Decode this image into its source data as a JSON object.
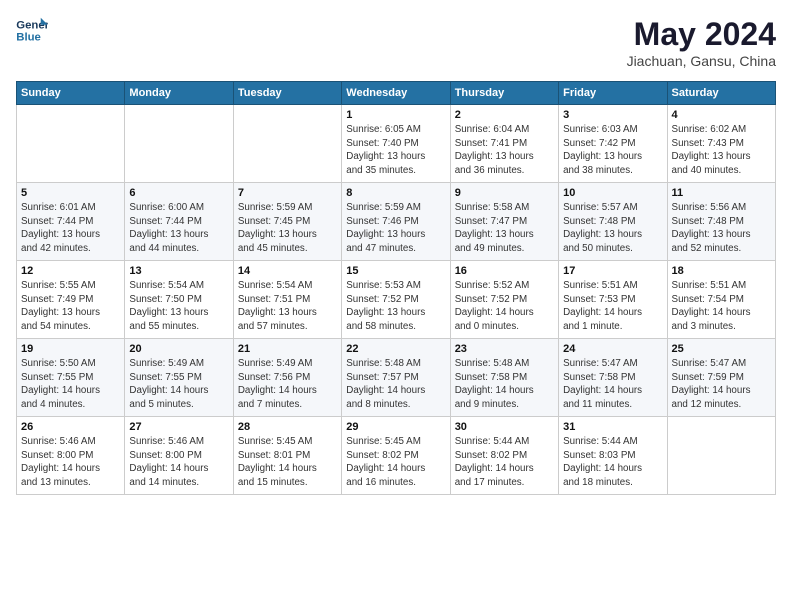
{
  "header": {
    "logo_line1": "General",
    "logo_line2": "Blue",
    "month_year": "May 2024",
    "location": "Jiachuan, Gansu, China"
  },
  "days_of_week": [
    "Sunday",
    "Monday",
    "Tuesday",
    "Wednesday",
    "Thursday",
    "Friday",
    "Saturday"
  ],
  "weeks": [
    [
      {
        "day": "",
        "info": ""
      },
      {
        "day": "",
        "info": ""
      },
      {
        "day": "",
        "info": ""
      },
      {
        "day": "1",
        "info": "Sunrise: 6:05 AM\nSunset: 7:40 PM\nDaylight: 13 hours\nand 35 minutes."
      },
      {
        "day": "2",
        "info": "Sunrise: 6:04 AM\nSunset: 7:41 PM\nDaylight: 13 hours\nand 36 minutes."
      },
      {
        "day": "3",
        "info": "Sunrise: 6:03 AM\nSunset: 7:42 PM\nDaylight: 13 hours\nand 38 minutes."
      },
      {
        "day": "4",
        "info": "Sunrise: 6:02 AM\nSunset: 7:43 PM\nDaylight: 13 hours\nand 40 minutes."
      }
    ],
    [
      {
        "day": "5",
        "info": "Sunrise: 6:01 AM\nSunset: 7:44 PM\nDaylight: 13 hours\nand 42 minutes."
      },
      {
        "day": "6",
        "info": "Sunrise: 6:00 AM\nSunset: 7:44 PM\nDaylight: 13 hours\nand 44 minutes."
      },
      {
        "day": "7",
        "info": "Sunrise: 5:59 AM\nSunset: 7:45 PM\nDaylight: 13 hours\nand 45 minutes."
      },
      {
        "day": "8",
        "info": "Sunrise: 5:59 AM\nSunset: 7:46 PM\nDaylight: 13 hours\nand 47 minutes."
      },
      {
        "day": "9",
        "info": "Sunrise: 5:58 AM\nSunset: 7:47 PM\nDaylight: 13 hours\nand 49 minutes."
      },
      {
        "day": "10",
        "info": "Sunrise: 5:57 AM\nSunset: 7:48 PM\nDaylight: 13 hours\nand 50 minutes."
      },
      {
        "day": "11",
        "info": "Sunrise: 5:56 AM\nSunset: 7:48 PM\nDaylight: 13 hours\nand 52 minutes."
      }
    ],
    [
      {
        "day": "12",
        "info": "Sunrise: 5:55 AM\nSunset: 7:49 PM\nDaylight: 13 hours\nand 54 minutes."
      },
      {
        "day": "13",
        "info": "Sunrise: 5:54 AM\nSunset: 7:50 PM\nDaylight: 13 hours\nand 55 minutes."
      },
      {
        "day": "14",
        "info": "Sunrise: 5:54 AM\nSunset: 7:51 PM\nDaylight: 13 hours\nand 57 minutes."
      },
      {
        "day": "15",
        "info": "Sunrise: 5:53 AM\nSunset: 7:52 PM\nDaylight: 13 hours\nand 58 minutes."
      },
      {
        "day": "16",
        "info": "Sunrise: 5:52 AM\nSunset: 7:52 PM\nDaylight: 14 hours\nand 0 minutes."
      },
      {
        "day": "17",
        "info": "Sunrise: 5:51 AM\nSunset: 7:53 PM\nDaylight: 14 hours\nand 1 minute."
      },
      {
        "day": "18",
        "info": "Sunrise: 5:51 AM\nSunset: 7:54 PM\nDaylight: 14 hours\nand 3 minutes."
      }
    ],
    [
      {
        "day": "19",
        "info": "Sunrise: 5:50 AM\nSunset: 7:55 PM\nDaylight: 14 hours\nand 4 minutes."
      },
      {
        "day": "20",
        "info": "Sunrise: 5:49 AM\nSunset: 7:55 PM\nDaylight: 14 hours\nand 5 minutes."
      },
      {
        "day": "21",
        "info": "Sunrise: 5:49 AM\nSunset: 7:56 PM\nDaylight: 14 hours\nand 7 minutes."
      },
      {
        "day": "22",
        "info": "Sunrise: 5:48 AM\nSunset: 7:57 PM\nDaylight: 14 hours\nand 8 minutes."
      },
      {
        "day": "23",
        "info": "Sunrise: 5:48 AM\nSunset: 7:58 PM\nDaylight: 14 hours\nand 9 minutes."
      },
      {
        "day": "24",
        "info": "Sunrise: 5:47 AM\nSunset: 7:58 PM\nDaylight: 14 hours\nand 11 minutes."
      },
      {
        "day": "25",
        "info": "Sunrise: 5:47 AM\nSunset: 7:59 PM\nDaylight: 14 hours\nand 12 minutes."
      }
    ],
    [
      {
        "day": "26",
        "info": "Sunrise: 5:46 AM\nSunset: 8:00 PM\nDaylight: 14 hours\nand 13 minutes."
      },
      {
        "day": "27",
        "info": "Sunrise: 5:46 AM\nSunset: 8:00 PM\nDaylight: 14 hours\nand 14 minutes."
      },
      {
        "day": "28",
        "info": "Sunrise: 5:45 AM\nSunset: 8:01 PM\nDaylight: 14 hours\nand 15 minutes."
      },
      {
        "day": "29",
        "info": "Sunrise: 5:45 AM\nSunset: 8:02 PM\nDaylight: 14 hours\nand 16 minutes."
      },
      {
        "day": "30",
        "info": "Sunrise: 5:44 AM\nSunset: 8:02 PM\nDaylight: 14 hours\nand 17 minutes."
      },
      {
        "day": "31",
        "info": "Sunrise: 5:44 AM\nSunset: 8:03 PM\nDaylight: 14 hours\nand 18 minutes."
      },
      {
        "day": "",
        "info": ""
      }
    ]
  ]
}
